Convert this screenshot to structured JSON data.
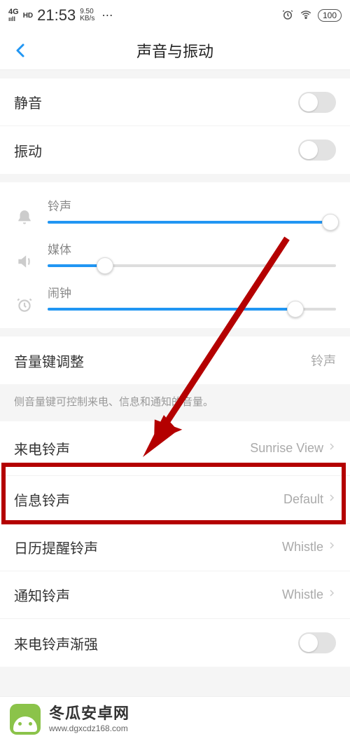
{
  "status": {
    "net": "4G",
    "hd": "HD",
    "time": "21:53",
    "rate_top": "9.50",
    "rate_bot": "KB/s",
    "battery": "100"
  },
  "header": {
    "title": "声音与振动"
  },
  "toggles": {
    "mute_label": "静音",
    "vibrate_label": "振动"
  },
  "sliders": {
    "ring_label": "铃声",
    "media_label": "媒体",
    "alarm_label": "闹钟",
    "ring_pct": 98,
    "media_pct": 20,
    "alarm_pct": 86
  },
  "vol_key": {
    "label": "音量键调整",
    "value": "铃声",
    "desc": "侧音量键可控制来电、信息和通知的音量。"
  },
  "ringtones": {
    "incoming_label": "来电铃声",
    "incoming_value": "Sunrise View",
    "message_label": "信息铃声",
    "message_value": "Default",
    "calendar_label": "日历提醒铃声",
    "calendar_value": "Whistle",
    "notify_label": "通知铃声",
    "notify_value": "Whistle",
    "ascend_label": "来电铃声渐强"
  },
  "footer": {
    "cn": "冬瓜安卓网",
    "en": "www.dgxcdz168.com"
  }
}
